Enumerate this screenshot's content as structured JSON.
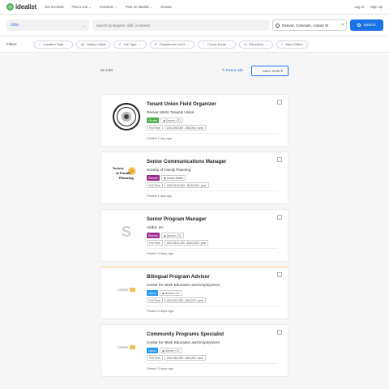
{
  "brand": {
    "name": "idealist"
  },
  "nav": {
    "items": [
      "Get Involved",
      "Find a Job ⌄",
      "Volunteer ⌄",
      "Post on Idealist ⌄",
      "Donate"
    ],
    "login": "Log In",
    "signup": "Sign Up"
  },
  "search": {
    "type_label": "Jobs",
    "keyword_placeholder": "Search by keyword, skill, or interest",
    "location_value": "Denver, Colorado, United St",
    "button_label": "Search"
  },
  "filters": {
    "label": "Filters",
    "chips": [
      {
        "icon": "⌂",
        "label": "Location Type"
      },
      {
        "icon": "▤",
        "label": "Salary Listed"
      },
      {
        "icon": "✐",
        "label": "Job Type"
      },
      {
        "icon": "✐",
        "label": "Experience Level"
      },
      {
        "icon": "♡",
        "label": "Cause Areas"
      },
      {
        "icon": "◎",
        "label": "Education"
      },
      {
        "icon": "+",
        "label": "More Filters"
      }
    ]
  },
  "results": {
    "count": "20 Jobs",
    "post_job": "Post a Job",
    "save_search": "Save Search"
  },
  "jobs": [
    {
      "title": "Tenant Union Field Organizer",
      "org": "Denver Metro Tenants Union",
      "mode": "On-site",
      "location": "Denver, CO",
      "job_type": "Full Time",
      "salary": "USD $50,000 - $55,000 / year",
      "posted": "Posted 1 day ago"
    },
    {
      "title": "Senior Communications Manager",
      "org": "Society of Family Planning",
      "mode": "Remote",
      "location": "United States",
      "job_type": "Full Time",
      "salary": "USD $100,000 - $130,000 / year",
      "posted": "Posted 1 day ago"
    },
    {
      "title": "Senior Program Manager",
      "org": "AidKit, Inc.",
      "mode": "Remote",
      "location": "Denver, CO",
      "job_type": "Full Time",
      "salary": "USD $110,000 - $140,000 / year",
      "posted": "Posted 3 days ago"
    },
    {
      "title": "Bilingual Program Advisor",
      "org": "Center for Work Education and Employment",
      "mode": "Hybrid",
      "location": "Denver, CO",
      "job_type": "Full Time",
      "salary": "USD $47,320 - $50,076 / year",
      "posted": "Posted 5 days ago"
    },
    {
      "title": "Community Programs Specialist",
      "org": "Center for Work Education and Employment",
      "mode": "Hybrid",
      "location": "Denver, CO",
      "job_type": "Full Time",
      "salary": "USD $52,000 - $56,260 / year",
      "posted": "Posted 5 days ago"
    }
  ],
  "logos": {
    "sfp_lines": [
      "Society",
      "of Family",
      "Planning"
    ],
    "aidkit_initial": "S",
    "cwee_text": "CWEE"
  },
  "icons": {
    "search": "search-icon",
    "pin": "pin-icon",
    "bookmark": "bookmark-icon",
    "clear": "×",
    "caret": "⌄",
    "location_mini": "◉",
    "save": "♡",
    "post": "✎"
  },
  "colors": {
    "brand": "#4bb05a",
    "accent": "#1a73e8",
    "onsite": "#4caf50",
    "remote": "#9c2f8f",
    "hybrid": "#2196f3"
  }
}
